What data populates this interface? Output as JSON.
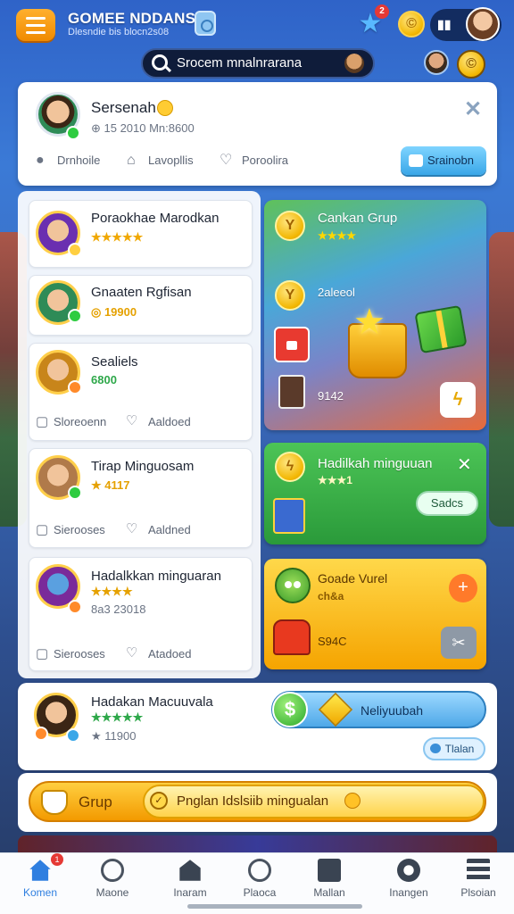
{
  "header": {
    "app_title": "GOMEE NDDANSIA",
    "app_subtitle": "Dlesndie bis blocn2s08",
    "notification_count": "2",
    "coin_symbol": "©"
  },
  "search": {
    "value": "Srocem mnalnrarana"
  },
  "profile_panel": {
    "name": "Sersenah",
    "meta": "⊕ 15 2010 Mn:8600",
    "actions": [
      {
        "icon": "chat-icon",
        "label": "Drnhoile"
      },
      {
        "icon": "bag-icon",
        "label": "Lavopllis"
      },
      {
        "icon": "heart-icon",
        "label": "Poroolira"
      }
    ],
    "button_label": "Srainobn"
  },
  "list": [
    {
      "title": "Poraokhae Marodkan",
      "sub": "★★★★★"
    },
    {
      "title": "Gnaaten Rgfisan",
      "sub": "◎ 19900"
    },
    {
      "title": "Sealiels",
      "sub": "6800",
      "foot_left": "Sloreoenn",
      "foot_right": "Aaldoed"
    },
    {
      "title": "Tirap Minguosam",
      "sub": "★ 4117",
      "foot_left": "Sierooses",
      "foot_right": "Aaldned"
    },
    {
      "title": "Hadalkkan minguaran",
      "sub": "★★★★",
      "sub2": "8a3 23018",
      "foot_left": "Sierooses",
      "foot_right": "Atadoed"
    }
  ],
  "promos": {
    "p1_title": "Cankan Grup",
    "p1_stars": "★★★★",
    "p1_label_a": "2aleeol",
    "p1_label_b": "9142",
    "p2_title": "Hadilkah minguuan",
    "p2_stars": "★★★1",
    "p2_button": "Sadcs",
    "p3_title": "Goade Vurel",
    "p3_sub": "ch&a",
    "p3_label": "S94C"
  },
  "wide_card": {
    "title": "Hadakan Macuuvala",
    "stars": "★★★★★",
    "sub": "★ 11900",
    "pill_label": "Neliyuubah",
    "button_label": "Tlalan"
  },
  "group": {
    "label": "Grup",
    "inner_label": "Pnglan Idslsiib mingualan"
  },
  "nav": [
    {
      "label": "Komen",
      "active": true
    },
    {
      "label": "Maone"
    },
    {
      "label": "Inaram"
    },
    {
      "label": "Plaoca"
    },
    {
      "label": "Mallan"
    },
    {
      "label": "Inangen"
    },
    {
      "label": "Plsoian"
    }
  ],
  "colors": {
    "accent": "#2f7fe0",
    "orange": "#f39a00",
    "green_panel": "#2ea84a",
    "badge_red": "#e53935"
  }
}
